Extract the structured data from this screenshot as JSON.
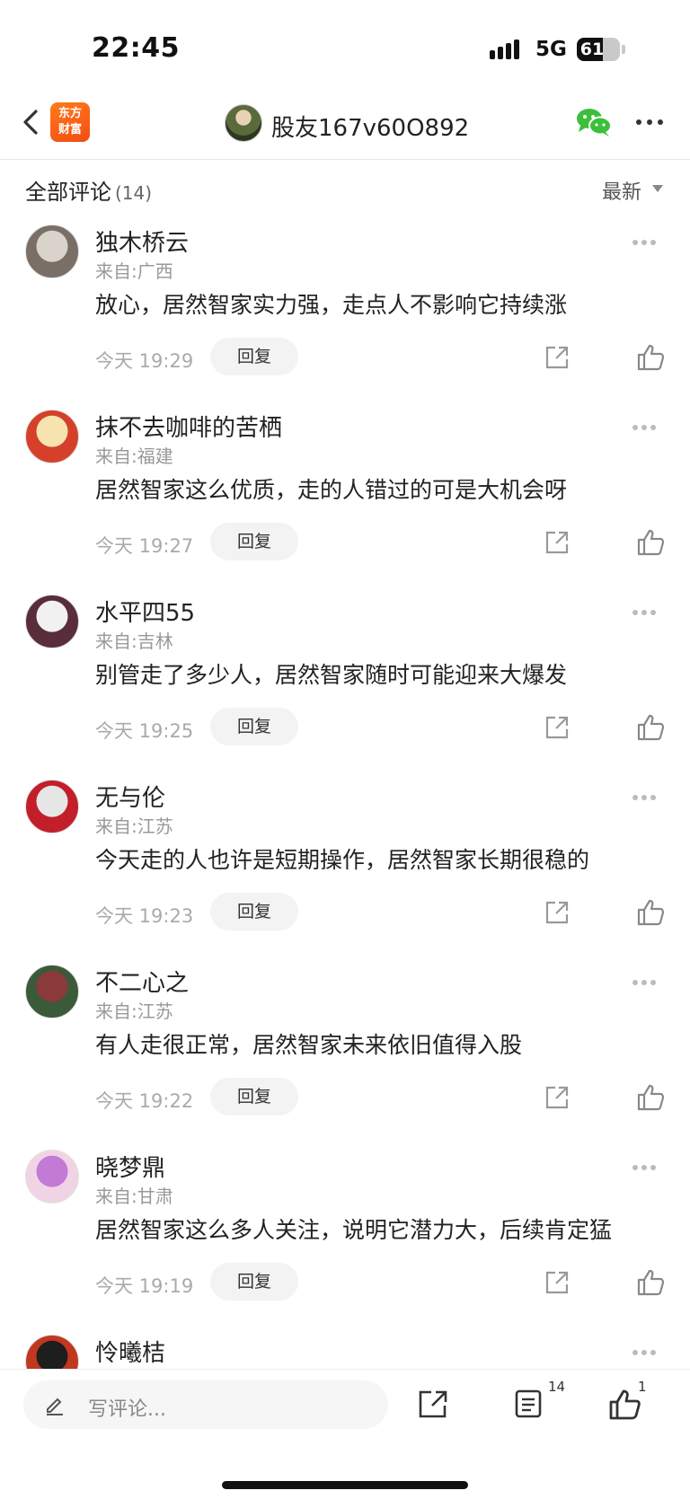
{
  "status_bar": {
    "time": "22:45",
    "network": "5G",
    "battery_level": "61"
  },
  "header": {
    "brand_logo_line1": "东方",
    "brand_logo_line2": "财富",
    "title": "股友167v60O892",
    "icons": [
      "back-arrow-icon",
      "wechat-icon",
      "more-dots-icon"
    ]
  },
  "comments_bar": {
    "title": "全部评论",
    "count": "(14)",
    "sort_label": "最新"
  },
  "comments": [
    {
      "name": "独木桥云",
      "from": "来自:广西",
      "text": "放心，居然智家实力强，走点人不影响它持续涨",
      "time": "今天 19:29",
      "reply_label": "回复",
      "avatar_colors": [
        "#d9d3cc",
        "#7a6f66"
      ]
    },
    {
      "name": "抹不去咖啡的苦栖",
      "from": "来自:福建",
      "text": "居然智家这么优质，走的人错过的可是大机会呀",
      "time": "今天 19:27",
      "reply_label": "回复",
      "avatar_colors": [
        "#f6e3b0",
        "#d6402b"
      ]
    },
    {
      "name": "水平四55",
      "from": "来自:吉林",
      "text": "别管走了多少人，居然智家随时可能迎来大爆发",
      "time": "今天 19:25",
      "reply_label": "回复",
      "avatar_colors": [
        "#f1f1f1",
        "#5a2d3a"
      ]
    },
    {
      "name": "无与伦",
      "from": "来自:江苏",
      "text": "今天走的人也许是短期操作，居然智家长期很稳的",
      "time": "今天 19:23",
      "reply_label": "回复",
      "avatar_colors": [
        "#e6e6e6",
        "#c21f2a"
      ]
    },
    {
      "name": "不二心之",
      "from": "来自:江苏",
      "text": "有人走很正常，居然智家未来依旧值得入股",
      "time": "今天 19:22",
      "reply_label": "回复",
      "avatar_colors": [
        "#8a3a3a",
        "#3b5a3a"
      ]
    },
    {
      "name": "晓梦鼎",
      "from": "来自:甘肃",
      "text": "居然智家这么多人关注，说明它潜力大，后续肯定猛",
      "time": "今天 19:19",
      "reply_label": "回复",
      "avatar_colors": [
        "#c27ad6",
        "#f1d3e6"
      ]
    },
    {
      "name": "怜曦桔",
      "from": "",
      "text": "",
      "time": "",
      "reply_label": "",
      "avatar_colors": [
        "#1e1e1e",
        "#c2371f"
      ]
    }
  ],
  "bottom_bar": {
    "input_placeholder": "写评论...",
    "comments_count": "14",
    "likes_count": "1"
  }
}
